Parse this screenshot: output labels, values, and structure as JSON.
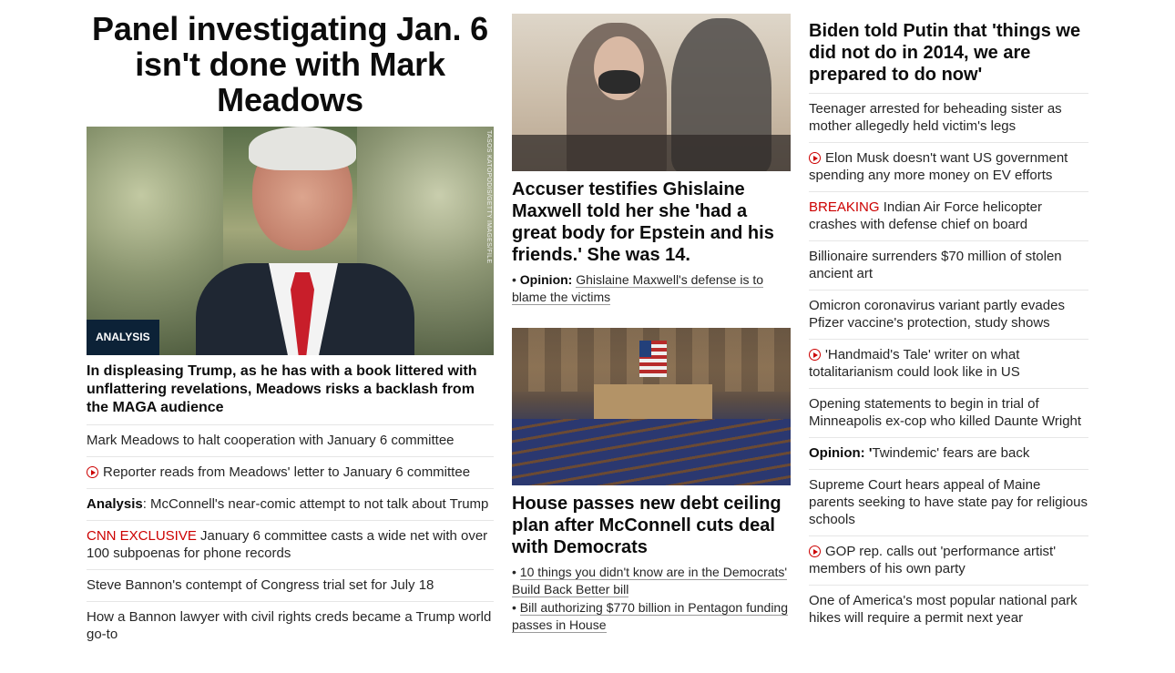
{
  "col1": {
    "headline": "Panel investigating Jan. 6 isn't done with Mark Meadows",
    "image_credit": "TASOS KATOPODIS/GETTY IMAGES/FILE",
    "badge": "ANALYSIS",
    "subhead": "In displeasing Trump, as he has with a book littered with unflattering revelations, Meadows risks a backlash from the MAGA audience",
    "items": [
      {
        "prefix": "",
        "text": "Mark Meadows to halt cooperation with January 6 committee"
      },
      {
        "prefix": "",
        "text": "Reporter reads from Meadows' letter to January 6 committee",
        "video": true
      },
      {
        "prefix": "Analysis",
        "text": ": McConnell's near-comic attempt to not talk about Trump"
      },
      {
        "prefix": "CNN EXCLUSIVE",
        "text": " January 6 committee casts a wide net with over 100 subpoenas for phone records"
      },
      {
        "prefix": "",
        "text": "Steve Bannon's contempt of Congress trial set for July 18"
      },
      {
        "prefix": "",
        "text": "How a Bannon lawyer with civil rights creds became a Trump world go-to"
      }
    ]
  },
  "col2": {
    "story1": {
      "headline": "Accuser testifies Ghislaine Maxwell told her she 'had a great body for Epstein and his friends.' She was 14.",
      "link_label": "Opinion:",
      "link_text": "Ghislaine Maxwell's defense is to blame the victims"
    },
    "story2": {
      "headline": "House passes new debt ceiling plan after McConnell cuts deal with Democrats",
      "links": [
        "10 things you didn't know are in the Democrats' Build Back Better bill",
        "Bill authorizing $770 billion in Pentagon funding passes in House"
      ]
    }
  },
  "col3": {
    "headline": "Biden told Putin that 'things we did not do in 2014, we are prepared to do now'",
    "items": [
      {
        "prefix": "",
        "text": "Teenager arrested for beheading sister as mother allegedly held victim's legs"
      },
      {
        "prefix": "",
        "text": "Elon Musk doesn't want US government spending any more money on EV efforts",
        "video": true
      },
      {
        "prefix": "BREAKING",
        "text": " Indian Air Force helicopter crashes with defense chief on board"
      },
      {
        "prefix": "",
        "text": "Billionaire surrenders $70 million of stolen ancient art"
      },
      {
        "prefix": "",
        "text": "Omicron coronavirus variant partly evades Pfizer vaccine's protection, study shows"
      },
      {
        "prefix": "",
        "text": "'Handmaid's Tale' writer on what totalitarianism could look like in US",
        "video": true
      },
      {
        "prefix": "",
        "text": "Opening statements to begin in trial of Minneapolis ex-cop who killed Daunte Wright"
      },
      {
        "prefix": "Opinion: '",
        "text": "Twindemic' fears are back"
      },
      {
        "prefix": "",
        "text": "Supreme Court hears appeal of Maine parents seeking to have state pay for religious schools"
      },
      {
        "prefix": "",
        "text": "GOP rep. calls out 'performance artist' members of his own party",
        "video": true
      },
      {
        "prefix": "",
        "text": "One of America's most popular national park hikes will require a permit next year"
      }
    ]
  },
  "colors": {
    "accent_red": "#cc0000",
    "badge_bg": "#0c2237",
    "divider": "#e6e6e6"
  }
}
